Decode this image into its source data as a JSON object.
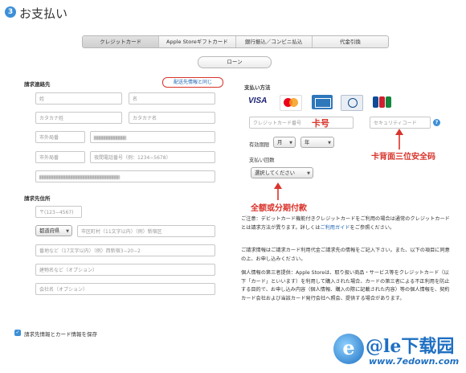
{
  "header": {
    "step": "3",
    "title": "お支払い"
  },
  "tabs": [
    {
      "label": "クレジットカード",
      "active": true
    },
    {
      "label": "Apple Storeギフトカード",
      "active": false
    },
    {
      "label": "銀行振込／コンビニ払込",
      "active": false
    },
    {
      "label": "代金引換",
      "active": false
    }
  ],
  "loan_label": "ローン",
  "billing": {
    "section_title": "請求連絡先",
    "same_as_shipping": "配送先情報と同じ",
    "last_name_placeholder": "姓",
    "first_name_placeholder": "名",
    "last_name_kana_placeholder": "カタカナ姓",
    "first_name_kana_placeholder": "カタカナ名",
    "area_code_placeholder": "市外局番",
    "phone_placeholder": "夜間電話番号（例：1234−5678）"
  },
  "address": {
    "section_title": "請求先住所",
    "postal_placeholder": "〒(123−4567)",
    "prefecture_select": "都道府県",
    "city_placeholder": "市区町村（11文字以内）（例）新宿区",
    "street_placeholder": "番地など（17文字以内）（例）西新宿3−20−2",
    "building_placeholder": "建物名など（オプション）",
    "company_placeholder": "会社名（オプション）"
  },
  "payment": {
    "section_title": "支払い方法",
    "cards": [
      "VISA",
      "MasterCard",
      "American Express",
      "Diners Club",
      "JCB"
    ],
    "card_number_placeholder": "クレジットカード番号",
    "security_code_placeholder": "セキュリティコード",
    "expiry_label": "有効期限",
    "month_select": "月",
    "year_select": "年",
    "installments_label": "支払い回数",
    "installments_select": "選択してください"
  },
  "annotations": {
    "card_number": "卡号",
    "security_code": "卡背面三位安全码",
    "installments": "全额或分期付款"
  },
  "notes": {
    "notice_before": "ご注意：デビットカード機能付きクレジットカードをご利用の場合は通常のクレジットカードとは請求方法が異ります。詳しくは",
    "notice_link": "ご利用ガイド",
    "notice_after": "をご参照ください。",
    "consent": "ご請求情報はご請求カード利用代金ご請求先の情報をご記入下さい。また、以下の項目に同意の上、お申し込みください。",
    "third_party": "個人情報の第三者提供：Apple Storeは、取り扱い商品・サービス等をクレジットカード（以下「カード」といいます）を利用して購入された場合、カードの第三者による不正利用を防止する目的で、お申し込み内容（個人情報、購入の際に記載された内容）等の個人情報を、契約カード会社および当該カード発行会社へ照会、提供する場合があります。"
  },
  "save_label": "請求先情報とカード情報を保存",
  "watermark": {
    "text": "@le下载园",
    "url": "www.7edown.com",
    "logo": "e"
  },
  "colors": {
    "accent": "#3c8fd8",
    "annotation": "#d8342b",
    "link": "#1f66b4"
  }
}
